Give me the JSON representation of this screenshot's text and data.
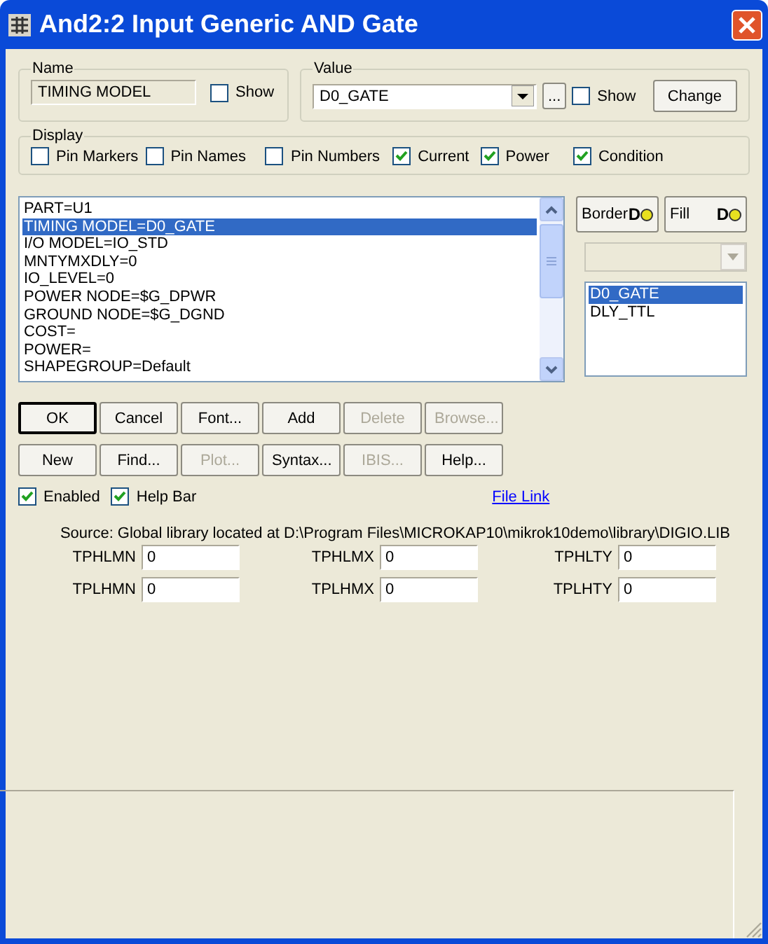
{
  "window": {
    "title": "And2:2 Input Generic AND Gate"
  },
  "name_group": {
    "label": "Name",
    "value": "TIMING MODEL",
    "show": {
      "label": "Show",
      "checked": false
    }
  },
  "value_group": {
    "label": "Value",
    "value": "D0_GATE",
    "browse": "...",
    "show": {
      "label": "Show",
      "checked": false
    },
    "change": "Change"
  },
  "display": {
    "label": "Display",
    "options": [
      {
        "label": "Pin Markers",
        "checked": false
      },
      {
        "label": "Pin Names",
        "checked": false
      },
      {
        "label": "Pin Numbers",
        "checked": false
      },
      {
        "label": "Current",
        "checked": true
      },
      {
        "label": "Power",
        "checked": true
      },
      {
        "label": "Condition",
        "checked": true
      }
    ]
  },
  "attributes": [
    {
      "text": "PART=U1",
      "selected": false
    },
    {
      "text": "TIMING MODEL=D0_GATE",
      "selected": true
    },
    {
      "text": "I/O MODEL=IO_STD",
      "selected": false
    },
    {
      "text": "MNTYMXDLY=0",
      "selected": false
    },
    {
      "text": "IO_LEVEL=0",
      "selected": false
    },
    {
      "text": "POWER NODE=$G_DPWR",
      "selected": false
    },
    {
      "text": "GROUND NODE=$G_DGND",
      "selected": false
    },
    {
      "text": "COST=",
      "selected": false
    },
    {
      "text": "POWER=",
      "selected": false
    },
    {
      "text": "SHAPEGROUP=Default",
      "selected": false
    }
  ],
  "border_button": "Border",
  "fill_button": "Fill",
  "border_icon_letter": "D",
  "fill_icon_letter": "D",
  "models": [
    {
      "text": "D0_GATE",
      "selected": true
    },
    {
      "text": "DLY_TTL",
      "selected": false
    }
  ],
  "button_rows": [
    [
      {
        "label": "OK",
        "disabled": false
      },
      {
        "label": "Cancel",
        "disabled": false
      },
      {
        "label": "Font...",
        "disabled": false
      },
      {
        "label": "Add",
        "disabled": false
      },
      {
        "label": "Delete",
        "disabled": true
      },
      {
        "label": "Browse...",
        "disabled": true
      }
    ],
    [
      {
        "label": "New",
        "disabled": false
      },
      {
        "label": "Find...",
        "disabled": false
      },
      {
        "label": "Plot...",
        "disabled": true
      },
      {
        "label": "Syntax...",
        "disabled": false
      },
      {
        "label": "IBIS...",
        "disabled": true
      },
      {
        "label": "Help...",
        "disabled": false
      }
    ]
  ],
  "options": [
    {
      "label": "Enabled",
      "checked": true
    },
    {
      "label": "Help Bar",
      "checked": true
    }
  ],
  "file_link": "File Link",
  "source": "Source: Global library located at D:\\Program Files\\MICROKAP10\\mikrok10demo\\library\\DIGIO.LIB",
  "params": [
    {
      "label": "TPHLMN",
      "value": "0"
    },
    {
      "label": "TPHLMX",
      "value": "0"
    },
    {
      "label": "TPHLTY",
      "value": "0"
    },
    {
      "label": "TPLHMN",
      "value": "0"
    },
    {
      "label": "TPLHMX",
      "value": "0"
    },
    {
      "label": "TPLHTY",
      "value": "0"
    }
  ]
}
